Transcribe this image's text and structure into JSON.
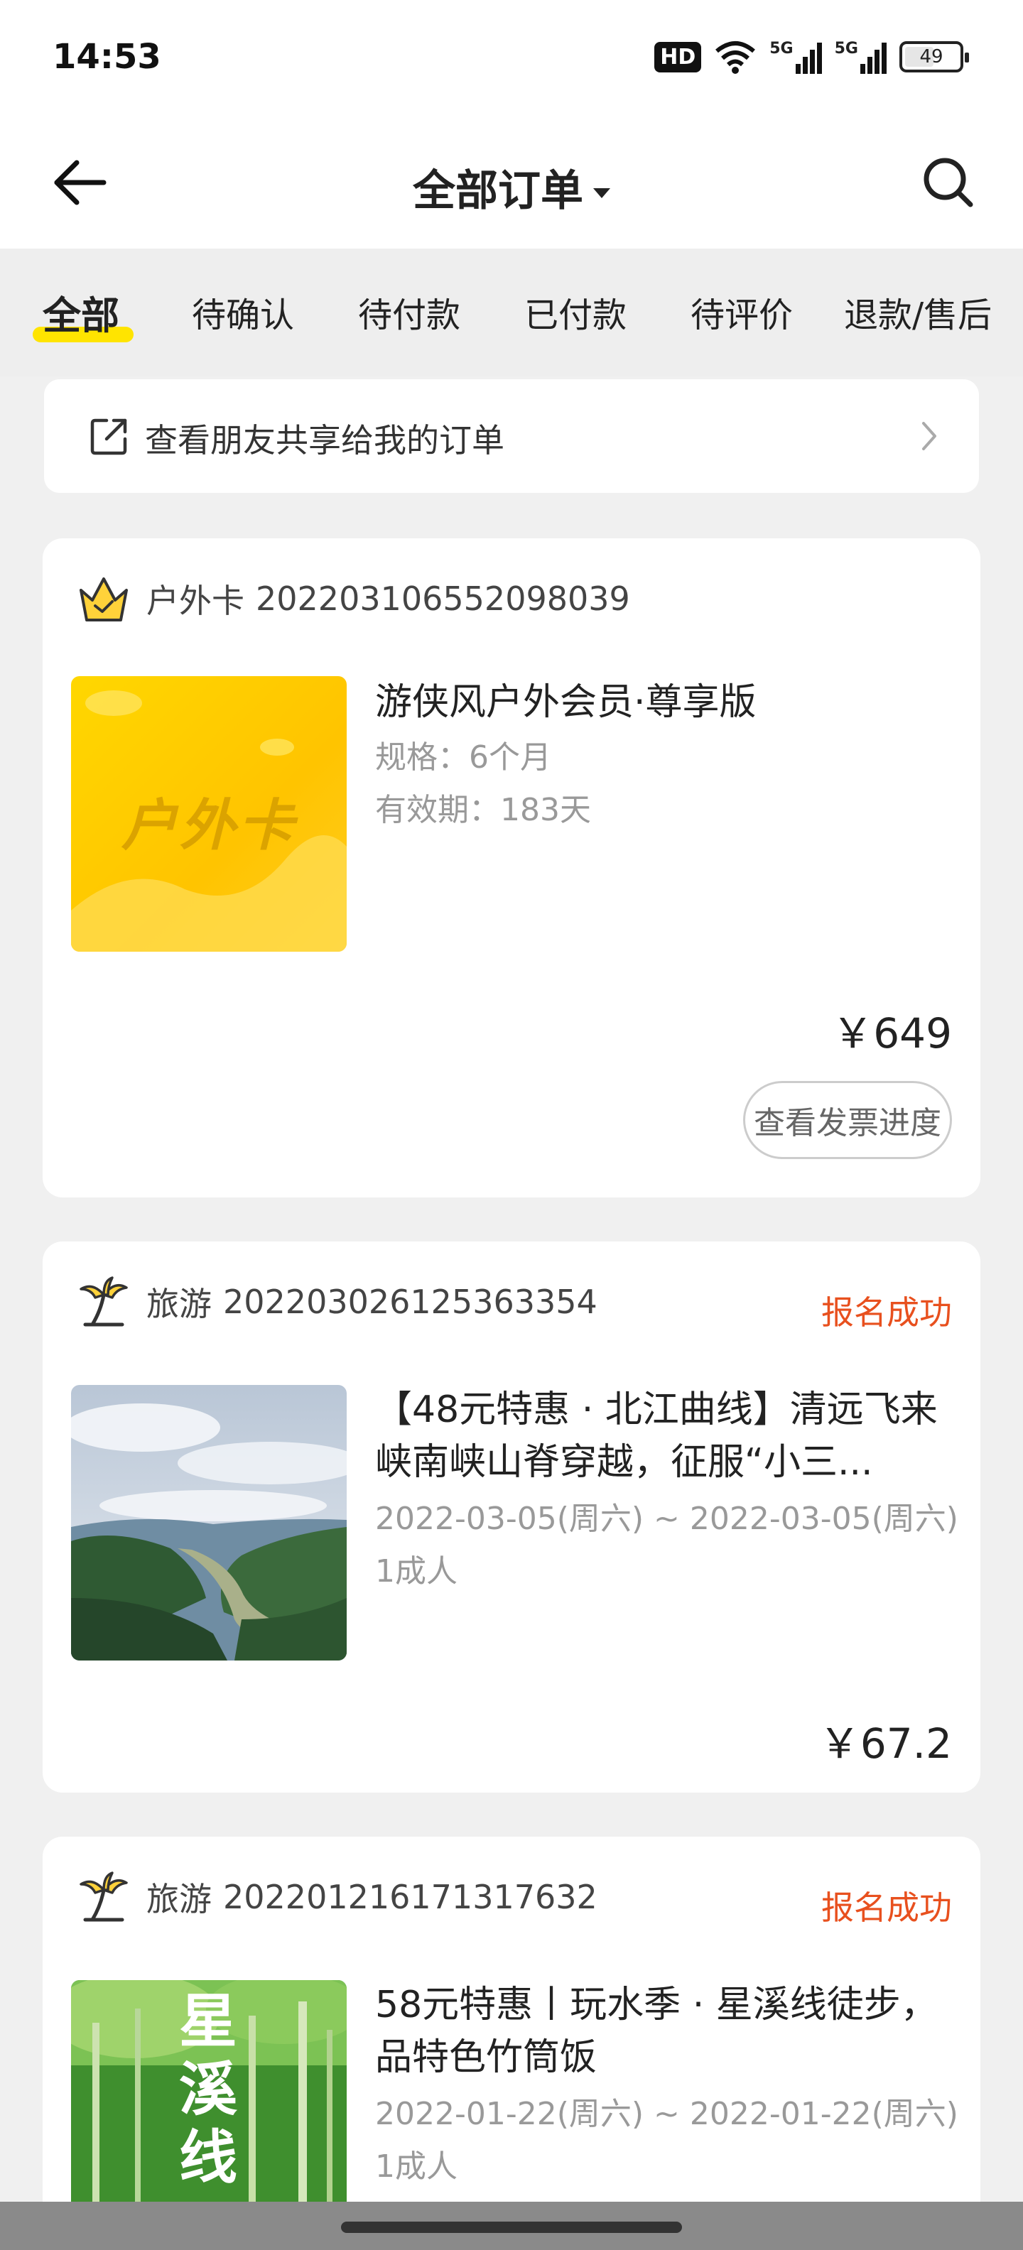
{
  "status_bar": {
    "time": "14:53",
    "hd_label": "HD",
    "network_1": "5G",
    "network_2": "5G",
    "battery_level": "49"
  },
  "header": {
    "title": "全部订单",
    "back_icon": "arrow-left-icon",
    "search_icon": "search-icon"
  },
  "tabs": [
    {
      "label": "全部",
      "active": true
    },
    {
      "label": "待确认",
      "active": false
    },
    {
      "label": "待付款",
      "active": false
    },
    {
      "label": "已付款",
      "active": false
    },
    {
      "label": "待评价",
      "active": false
    },
    {
      "label": "退款/售后",
      "active": false
    }
  ],
  "share_banner": {
    "text": "查看朋友共享给我的订单"
  },
  "orders": [
    {
      "category": "户外卡",
      "order_no": "202203106552098039",
      "status": "",
      "thumb_text": "户外卡",
      "title": "游侠风户外会员·尊享版",
      "meta_1": "规格：6个月",
      "meta_2": "有效期：183天",
      "price": "￥649",
      "action": "查看发票进度"
    },
    {
      "category": "旅游",
      "order_no": "202203026125363354",
      "status": "报名成功",
      "title": "【48元特惠 · 北江曲线】清远飞来峡南峡山脊穿越，征服“小三...",
      "meta_1": "2022-03-05(周六) ~ 2022-03-05(周六)",
      "meta_2": "1成人",
      "price": "￥67.2"
    },
    {
      "category": "旅游",
      "order_no": "202201216171317632",
      "status": "报名成功",
      "thumb_text": "星溪线",
      "title": "58元特惠丨玩水季 · 星溪线徒步，品特色竹筒饭",
      "meta_1": "2022-01-22(周六) ~ 2022-01-22(周六)",
      "meta_2": "1成人"
    }
  ],
  "colors": {
    "accent_yellow": "#ffe400",
    "status_orange": "#e8501e"
  }
}
